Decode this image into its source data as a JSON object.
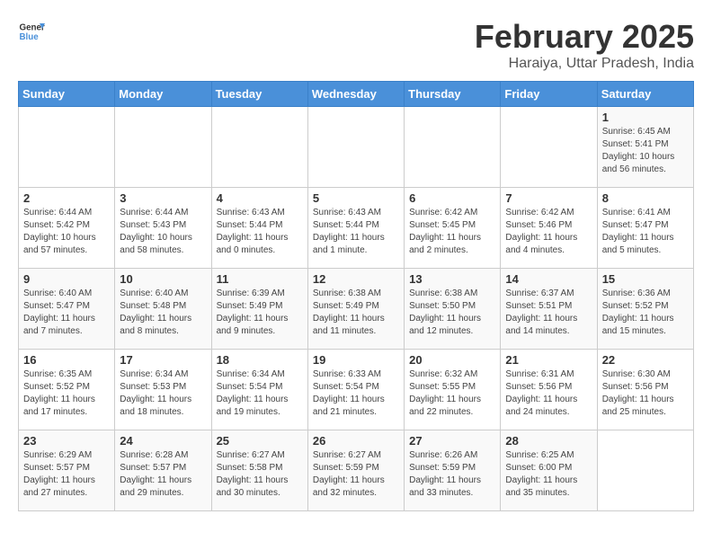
{
  "header": {
    "logo_general": "General",
    "logo_blue": "Blue",
    "month": "February 2025",
    "location": "Haraiya, Uttar Pradesh, India"
  },
  "weekdays": [
    "Sunday",
    "Monday",
    "Tuesday",
    "Wednesday",
    "Thursday",
    "Friday",
    "Saturday"
  ],
  "weeks": [
    [
      {
        "day": "",
        "info": ""
      },
      {
        "day": "",
        "info": ""
      },
      {
        "day": "",
        "info": ""
      },
      {
        "day": "",
        "info": ""
      },
      {
        "day": "",
        "info": ""
      },
      {
        "day": "",
        "info": ""
      },
      {
        "day": "1",
        "info": "Sunrise: 6:45 AM\nSunset: 5:41 PM\nDaylight: 10 hours\nand 56 minutes."
      }
    ],
    [
      {
        "day": "2",
        "info": "Sunrise: 6:44 AM\nSunset: 5:42 PM\nDaylight: 10 hours\nand 57 minutes."
      },
      {
        "day": "3",
        "info": "Sunrise: 6:44 AM\nSunset: 5:43 PM\nDaylight: 10 hours\nand 58 minutes."
      },
      {
        "day": "4",
        "info": "Sunrise: 6:43 AM\nSunset: 5:44 PM\nDaylight: 11 hours\nand 0 minutes."
      },
      {
        "day": "5",
        "info": "Sunrise: 6:43 AM\nSunset: 5:44 PM\nDaylight: 11 hours\nand 1 minute."
      },
      {
        "day": "6",
        "info": "Sunrise: 6:42 AM\nSunset: 5:45 PM\nDaylight: 11 hours\nand 2 minutes."
      },
      {
        "day": "7",
        "info": "Sunrise: 6:42 AM\nSunset: 5:46 PM\nDaylight: 11 hours\nand 4 minutes."
      },
      {
        "day": "8",
        "info": "Sunrise: 6:41 AM\nSunset: 5:47 PM\nDaylight: 11 hours\nand 5 minutes."
      }
    ],
    [
      {
        "day": "9",
        "info": "Sunrise: 6:40 AM\nSunset: 5:47 PM\nDaylight: 11 hours\nand 7 minutes."
      },
      {
        "day": "10",
        "info": "Sunrise: 6:40 AM\nSunset: 5:48 PM\nDaylight: 11 hours\nand 8 minutes."
      },
      {
        "day": "11",
        "info": "Sunrise: 6:39 AM\nSunset: 5:49 PM\nDaylight: 11 hours\nand 9 minutes."
      },
      {
        "day": "12",
        "info": "Sunrise: 6:38 AM\nSunset: 5:49 PM\nDaylight: 11 hours\nand 11 minutes."
      },
      {
        "day": "13",
        "info": "Sunrise: 6:38 AM\nSunset: 5:50 PM\nDaylight: 11 hours\nand 12 minutes."
      },
      {
        "day": "14",
        "info": "Sunrise: 6:37 AM\nSunset: 5:51 PM\nDaylight: 11 hours\nand 14 minutes."
      },
      {
        "day": "15",
        "info": "Sunrise: 6:36 AM\nSunset: 5:52 PM\nDaylight: 11 hours\nand 15 minutes."
      }
    ],
    [
      {
        "day": "16",
        "info": "Sunrise: 6:35 AM\nSunset: 5:52 PM\nDaylight: 11 hours\nand 17 minutes."
      },
      {
        "day": "17",
        "info": "Sunrise: 6:34 AM\nSunset: 5:53 PM\nDaylight: 11 hours\nand 18 minutes."
      },
      {
        "day": "18",
        "info": "Sunrise: 6:34 AM\nSunset: 5:54 PM\nDaylight: 11 hours\nand 19 minutes."
      },
      {
        "day": "19",
        "info": "Sunrise: 6:33 AM\nSunset: 5:54 PM\nDaylight: 11 hours\nand 21 minutes."
      },
      {
        "day": "20",
        "info": "Sunrise: 6:32 AM\nSunset: 5:55 PM\nDaylight: 11 hours\nand 22 minutes."
      },
      {
        "day": "21",
        "info": "Sunrise: 6:31 AM\nSunset: 5:56 PM\nDaylight: 11 hours\nand 24 minutes."
      },
      {
        "day": "22",
        "info": "Sunrise: 6:30 AM\nSunset: 5:56 PM\nDaylight: 11 hours\nand 25 minutes."
      }
    ],
    [
      {
        "day": "23",
        "info": "Sunrise: 6:29 AM\nSunset: 5:57 PM\nDaylight: 11 hours\nand 27 minutes."
      },
      {
        "day": "24",
        "info": "Sunrise: 6:28 AM\nSunset: 5:57 PM\nDaylight: 11 hours\nand 29 minutes."
      },
      {
        "day": "25",
        "info": "Sunrise: 6:27 AM\nSunset: 5:58 PM\nDaylight: 11 hours\nand 30 minutes."
      },
      {
        "day": "26",
        "info": "Sunrise: 6:27 AM\nSunset: 5:59 PM\nDaylight: 11 hours\nand 32 minutes."
      },
      {
        "day": "27",
        "info": "Sunrise: 6:26 AM\nSunset: 5:59 PM\nDaylight: 11 hours\nand 33 minutes."
      },
      {
        "day": "28",
        "info": "Sunrise: 6:25 AM\nSunset: 6:00 PM\nDaylight: 11 hours\nand 35 minutes."
      },
      {
        "day": "",
        "info": ""
      }
    ]
  ]
}
